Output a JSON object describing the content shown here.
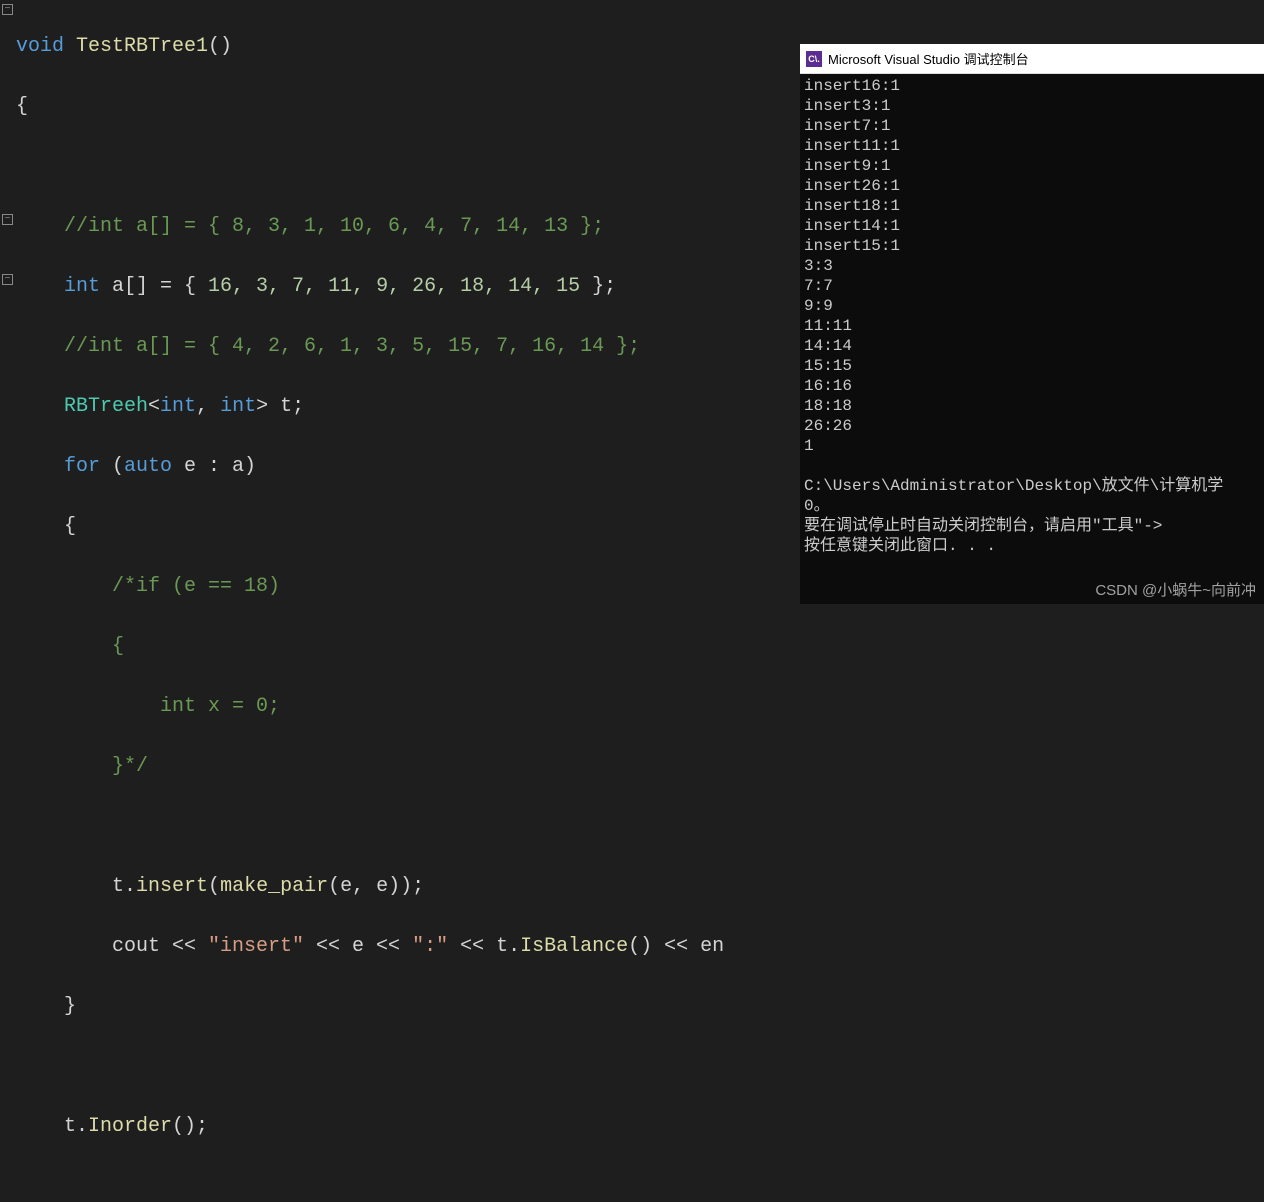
{
  "editor": {
    "l1_void": "void",
    "l1_fn": " TestRBTree1",
    "l1_paren": "()",
    "l2": "{",
    "l3_blank": "",
    "l4_cmt": "    //int a[] = { 8, 3, 1, 10, 6, 4, 7, 14, 13 };",
    "l5_int": "    int",
    "l5_rest1": " a[] = { ",
    "l5_nums": "16, 3, 7, 11, 9, 26, 18, 14, 15",
    "l5_rest2": " };",
    "l6_cmt": "    //int a[] = { 4, 2, 6, 1, 3, 5, 15, 7, 16, 14 };",
    "l7_type": "    RBTreeh",
    "l7_ang1": "<",
    "l7_int1": "int",
    "l7_comma": ", ",
    "l7_int2": "int",
    "l7_ang2": ">",
    "l7_t": " t;",
    "l8_for": "    for",
    "l8_open": " (",
    "l8_auto": "auto",
    "l8_rest": " e : a)",
    "l9": "    {",
    "l10_cmt": "        /*if (e == 18)",
    "l11_cmt": "        {",
    "l12_cmt": "            int x = 0;",
    "l13_cmt": "        }*/",
    "l14_blank": "",
    "l15a": "        t.",
    "l15_fn": "insert",
    "l15b": "(",
    "l15_fn2": "make_pair",
    "l15c": "(e, e));",
    "l16a": "        cout << ",
    "l16_s1": "\"insert\"",
    "l16b": " << e << ",
    "l16_s2": "\":\"",
    "l16c": " << t.",
    "l16_fn": "IsBalance",
    "l16d": "() << en",
    "l17": "    }",
    "l18_blank": "",
    "l19a": "    t.",
    "l19_fn": "Inorder",
    "l19b": "();"
  },
  "console": {
    "title": "Microsoft Visual Studio 调试控制台",
    "icon_text": "C\\.",
    "lines": [
      "insert16:1",
      "insert3:1",
      "insert7:1",
      "insert11:1",
      "insert9:1",
      "insert26:1",
      "insert18:1",
      "insert14:1",
      "insert15:1",
      "3:3",
      "7:7",
      "9:9",
      "11:11",
      "14:14",
      "15:15",
      "16:16",
      "18:18",
      "26:26",
      "1",
      "",
      "C:\\Users\\Administrator\\Desktop\\放文件\\计算机学",
      "0。",
      "要在调试停止时自动关闭控制台，请启用\"工具\"->",
      "按任意键关闭此窗口. . ."
    ]
  },
  "watermark": "CSDN @小蜗牛~向前冲"
}
